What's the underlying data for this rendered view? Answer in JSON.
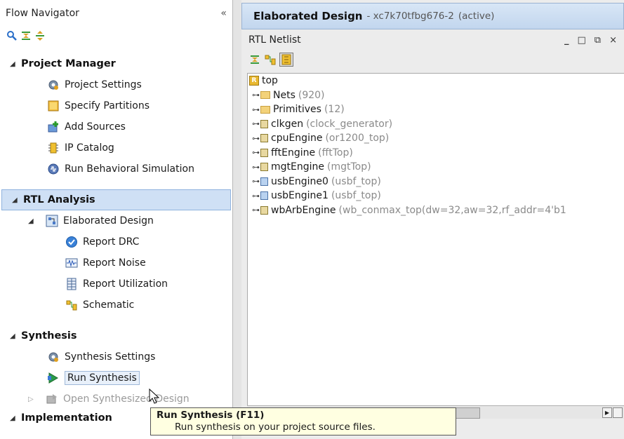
{
  "flow_navigator": {
    "title": "Flow Navigator",
    "collapse_glyph": "«",
    "toolbar_icons": [
      "search-icon",
      "collapse-all-icon",
      "expand-all-icon"
    ],
    "sections": {
      "project_manager": {
        "label": "Project Manager",
        "items": [
          "Project Settings",
          "Specify Partitions",
          "Add Sources",
          "IP Catalog",
          "Run Behavioral Simulation"
        ]
      },
      "rtl_analysis": {
        "label": "RTL Analysis",
        "elaborated": "Elaborated Design",
        "items": [
          "Report DRC",
          "Report Noise",
          "Report Utilization",
          "Schematic"
        ]
      },
      "synthesis": {
        "label": "Synthesis",
        "items": [
          "Synthesis Settings",
          "Run Synthesis",
          "Open Synthesized Design"
        ]
      },
      "implementation": {
        "label": "Implementation"
      }
    }
  },
  "design": {
    "title": "Elaborated Design",
    "part": "- xc7k70tfbg676-2",
    "status": "(active)"
  },
  "rtl_netlist": {
    "title": "RTL Netlist",
    "window_controls": [
      "_",
      "□",
      "⧉",
      "×"
    ],
    "tree": {
      "root": "top",
      "rows": [
        {
          "name": "Nets",
          "detail": "(920)"
        },
        {
          "name": "Primitives",
          "detail": "(12)"
        },
        {
          "name": "clkgen",
          "detail": "(clock_generator)"
        },
        {
          "name": "cpuEngine",
          "detail": "(or1200_top)"
        },
        {
          "name": "fftEngine",
          "detail": "(fftTop)"
        },
        {
          "name": "mgtEngine",
          "detail": "(mgtTop)"
        },
        {
          "name": "usbEngine0",
          "detail": "(usbf_top)"
        },
        {
          "name": "usbEngine1",
          "detail": "(usbf_top)"
        },
        {
          "name": "wbArbEngine",
          "detail": "(wb_conmax_top(dw=32,aw=32,rf_addr=4'b1"
        }
      ]
    }
  },
  "tooltip": {
    "title": "Run Synthesis (F11)",
    "text": "Run synthesis on your project source files."
  }
}
